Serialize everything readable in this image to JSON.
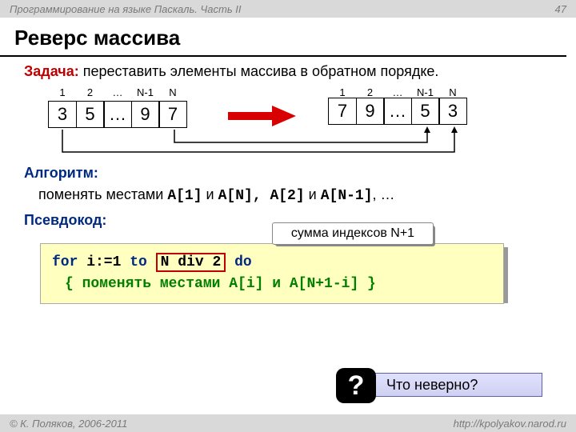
{
  "header": {
    "left": "Программирование на языке Паскаль. Часть II",
    "page": "47"
  },
  "title": "Реверс массива",
  "task": {
    "label": "Задача:",
    "text": " переставить элементы массива в обратном порядке."
  },
  "indices": [
    "1",
    "2",
    "…",
    "N-1",
    "N"
  ],
  "array_left": [
    "3",
    "5",
    "…",
    "9",
    "7"
  ],
  "array_right": [
    "7",
    "9",
    "…",
    "5",
    "3"
  ],
  "algo": {
    "label": "Алгоритм:",
    "text_prefix": "поменять местами ",
    "expr1": "A[1]",
    "and1": " и ",
    "expr2": "A[N]",
    "sep": ", ",
    "expr3": "A[2]",
    "and2": " и ",
    "expr4": "A[N-1]",
    "tail": ", …"
  },
  "callout": "сумма индексов N+1",
  "pseudo_label": "Псевдокод:",
  "code": {
    "kw_for": "for",
    "rng": " i:=1 ",
    "kw_to": "to",
    "limit": "N div 2",
    "kw_do": " do",
    "comment": "{ поменять местами A[i] и A[N+1-i] }"
  },
  "question": {
    "badge": "?",
    "text": "Что неверно?"
  },
  "footer": {
    "left": "© К. Поляков, 2006-2011",
    "right": "http://kpolyakov.narod.ru"
  }
}
